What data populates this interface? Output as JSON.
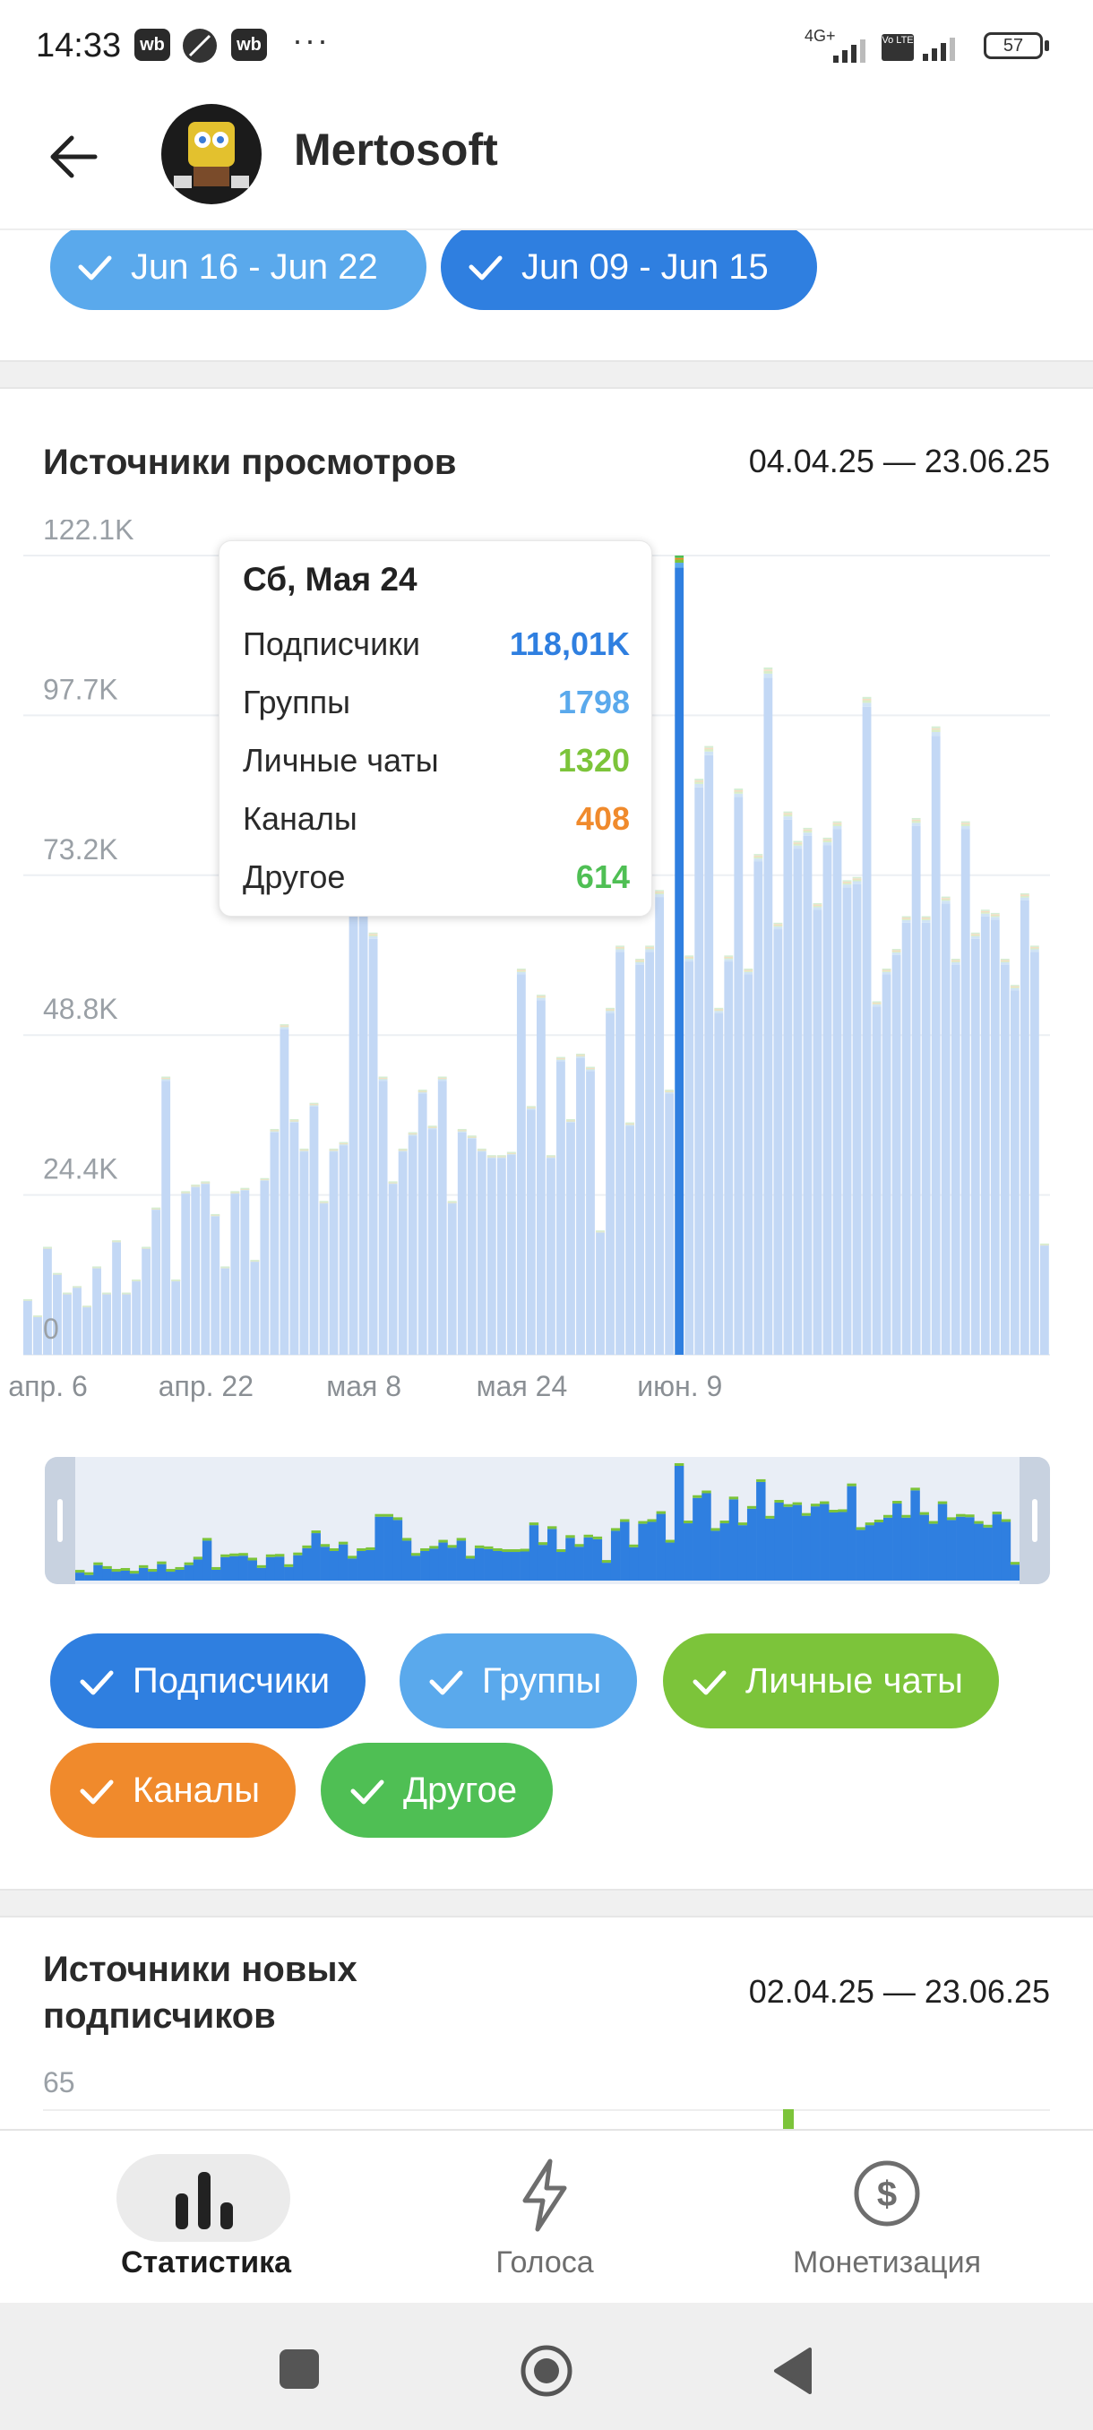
{
  "status_bar": {
    "time": "14:33",
    "app_chips": [
      "wb",
      "wb"
    ],
    "overflow": "···",
    "network": "4G+",
    "volte": "Vo LTE",
    "battery": "57"
  },
  "header": {
    "back_icon": "arrow-left-icon",
    "title": "Mertosoft"
  },
  "week_filters": [
    {
      "label": "Jun 16 - Jun 22",
      "color": "#5aa9ec"
    },
    {
      "label": "Jun 09 - Jun 15",
      "color": "#2f7fe0"
    }
  ],
  "views_section": {
    "title": "Источники просмотров",
    "range": "04.04.25 — 23.06.25"
  },
  "tooltip": {
    "date": "Сб, Мая 24",
    "rows": [
      {
        "label": "Подписчики",
        "value": "118,01K",
        "color": "#2f7fe0"
      },
      {
        "label": "Группы",
        "value": "1798",
        "color": "#5aa9ec"
      },
      {
        "label": "Личные чаты",
        "value": "1320",
        "color": "#7cc43a"
      },
      {
        "label": "Каналы",
        "value": "408",
        "color": "#f08a2c"
      },
      {
        "label": "Другое",
        "value": "614",
        "color": "#4fbf54"
      }
    ]
  },
  "chart_data": {
    "type": "bar",
    "stacked": true,
    "y_ticks": [
      "0",
      "24.4K",
      "48.8K",
      "73.2K",
      "97.7K",
      "122.1K"
    ],
    "ylim": [
      0,
      122100
    ],
    "x_ticks": [
      "апр. 6",
      "апр. 22",
      "мая 8",
      "мая 24",
      "июн. 9"
    ],
    "highlighted_date": "мая 24",
    "series_colors": {
      "Подписчики": "#2f7fe0",
      "Группы": "#5aa9ec",
      "Личные чаты": "#7cc43a",
      "Каналы": "#f08a2c",
      "Другое": "#4fbf54"
    },
    "daily_totals": [
      8500,
      6000,
      16500,
      12500,
      9500,
      10500,
      7500,
      13500,
      9500,
      17500,
      9500,
      11500,
      16500,
      22500,
      42500,
      11500,
      25000,
      26000,
      26500,
      21500,
      13500,
      25000,
      25500,
      14500,
      27000,
      34500,
      50500,
      36000,
      31500,
      38500,
      23500,
      31500,
      32500,
      68000,
      68000,
      64500,
      42500,
      26500,
      31500,
      34000,
      40500,
      35000,
      42500,
      23500,
      34500,
      33500,
      31500,
      30500,
      30500,
      31000,
      59000,
      38000,
      55000,
      30500,
      45500,
      36000,
      46000,
      44000,
      19000,
      53000,
      62500,
      35500,
      60500,
      62500,
      71000,
      40500,
      122100,
      61000,
      88000,
      93000,
      53000,
      61000,
      86500,
      59000,
      76500,
      105000,
      66000,
      83000,
      78500,
      80500,
      69000,
      79000,
      81500,
      72500,
      73000,
      100500,
      54000,
      59000,
      62000,
      67000,
      82000,
      67000,
      96000,
      70000,
      60500,
      81500,
      64500,
      68000,
      67500,
      60500,
      56500,
      70500,
      62500,
      17000
    ]
  },
  "series_filters": [
    {
      "label": "Подписчики",
      "color": "#2f7fe0"
    },
    {
      "label": "Группы",
      "color": "#5aa9ec"
    },
    {
      "label": "Личные чаты",
      "color": "#7cc43a"
    },
    {
      "label": "Каналы",
      "color": "#f08a2c"
    },
    {
      "label": "Другое",
      "color": "#4fbf54"
    }
  ],
  "subs_section": {
    "title_line1": "Источники новых",
    "title_line2": "подписчиков",
    "range": "02.04.25 — 23.06.25",
    "y_top_tick": "65"
  },
  "bottom_nav": [
    {
      "label": "Статистика",
      "icon": "bar-chart-icon",
      "active": true
    },
    {
      "label": "Голоса",
      "icon": "lightning-icon",
      "active": false
    },
    {
      "label": "Монетизация",
      "icon": "dollar-circle-icon",
      "active": false
    }
  ],
  "system_nav": [
    "square-icon",
    "home-circle-icon",
    "back-triangle-icon"
  ]
}
